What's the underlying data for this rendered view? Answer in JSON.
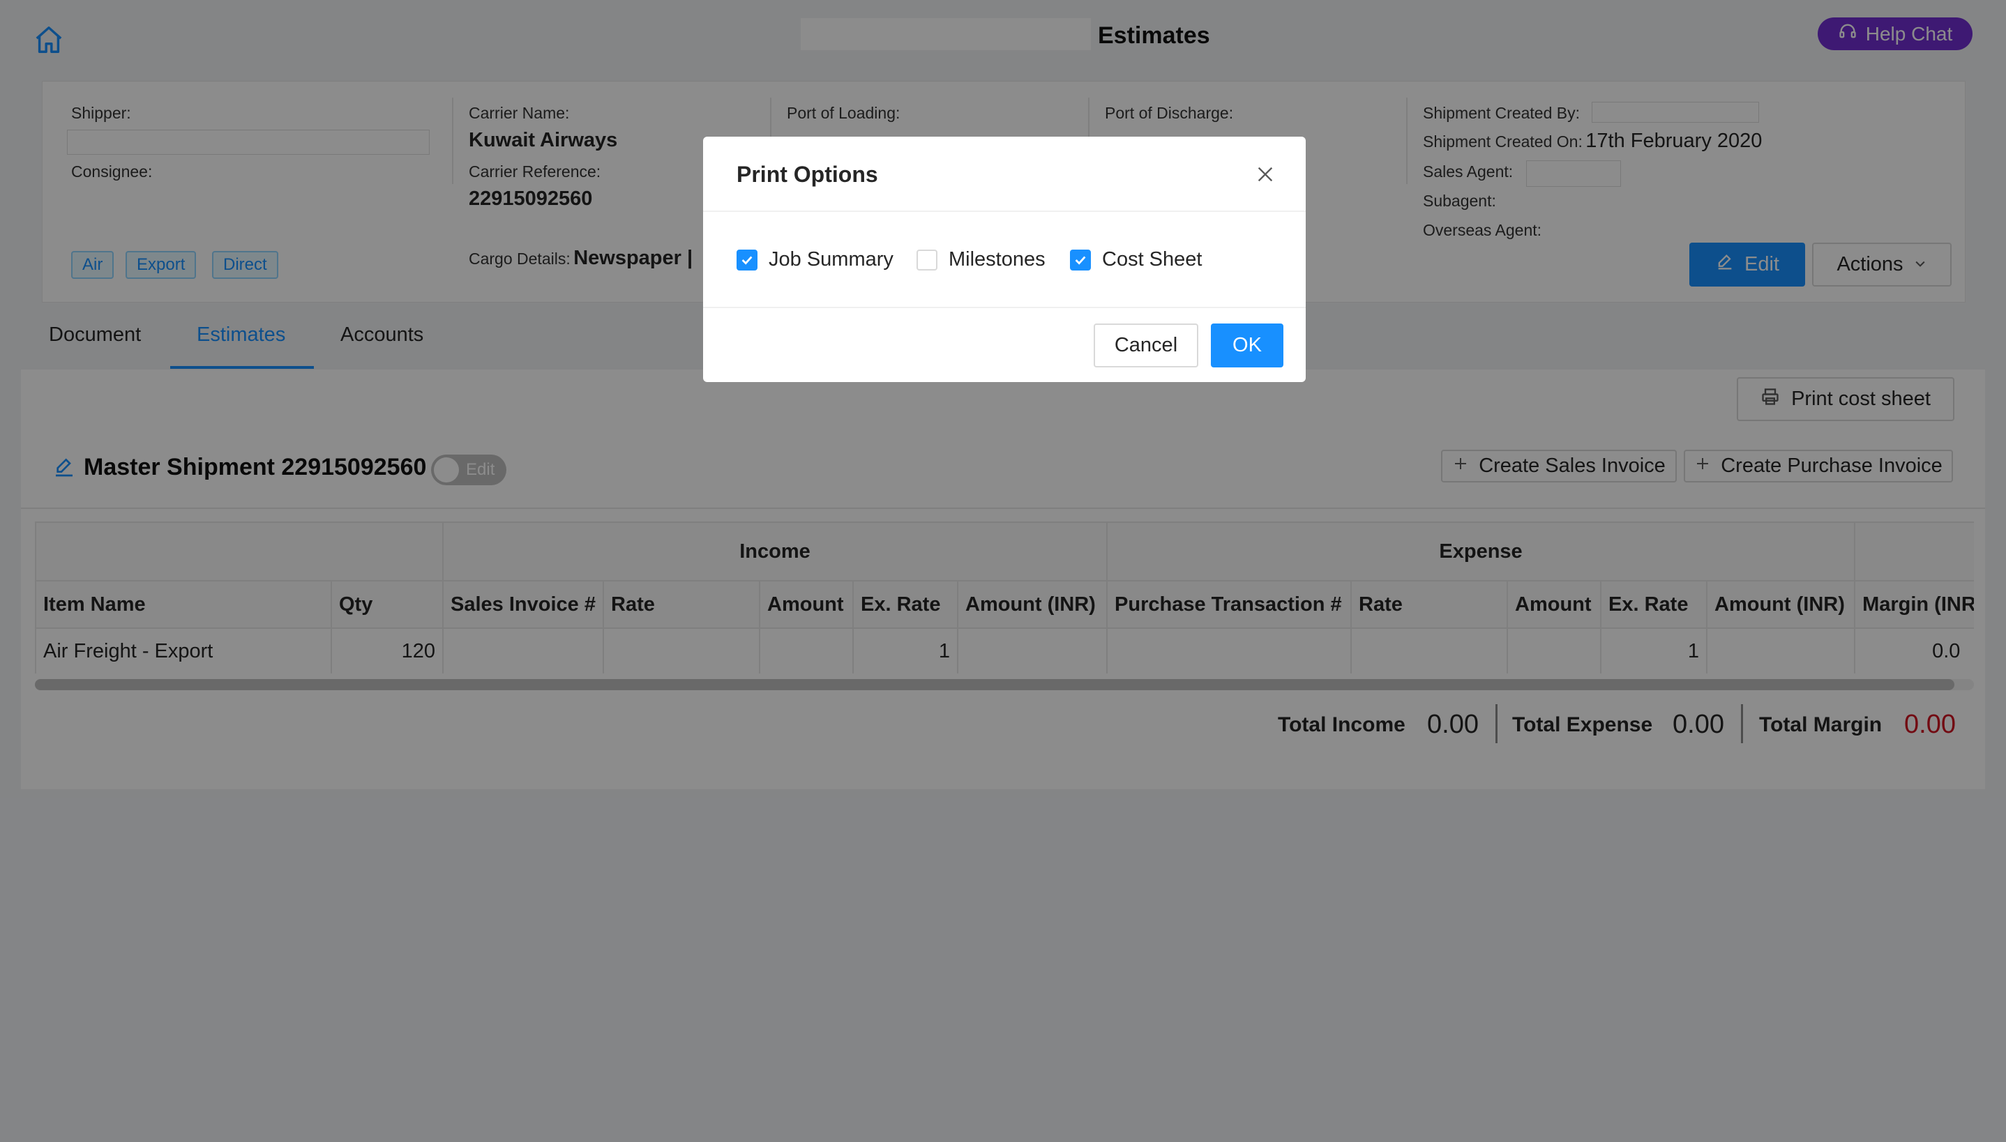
{
  "header": {
    "title": "Estimates",
    "help_chat_label": "Help Chat"
  },
  "shipment": {
    "shipper_label": "Shipper:",
    "consignee_label": "Consignee:",
    "tags": [
      "Air",
      "Export",
      "Direct"
    ],
    "carrier_name_label": "Carrier Name:",
    "carrier_name": "Kuwait Airways",
    "carrier_reference_label": "Carrier Reference:",
    "carrier_reference": "22915092560",
    "cargo_details_label": "Cargo Details:",
    "cargo_details": "Newspaper |",
    "port_loading_label": "Port of Loading:",
    "port_discharge_label": "Port of Discharge:",
    "created_by_label": "Shipment Created By:",
    "created_on_label": "Shipment Created On:",
    "created_on": "17th February 2020",
    "sales_agent_label": "Sales Agent:",
    "subagent_label": "Subagent:",
    "overseas_agent_label": "Overseas Agent:",
    "edit_label": "Edit",
    "actions_label": "Actions"
  },
  "tabs": [
    {
      "label": "Document",
      "active": false
    },
    {
      "label": "Estimates",
      "active": true
    },
    {
      "label": "Accounts",
      "active": false
    }
  ],
  "estimates": {
    "print_cost_sheet_label": "Print cost sheet",
    "master_title": "Master Shipment 22915092560",
    "switch_label": "Edit",
    "create_sales_invoice_label": "Create Sales Invoice",
    "create_purchase_invoice_label": "Create Purchase Invoice",
    "table": {
      "group_income": "Income",
      "group_expense": "Expense",
      "columns": [
        "Item Name",
        "Qty",
        "Sales Invoice #",
        "Rate",
        "Amount",
        "Ex. Rate",
        "Amount (INR)",
        "Purchase Transaction #",
        "Rate",
        "Amount",
        "Ex. Rate",
        "Amount (INR)",
        "Margin (INR)"
      ],
      "rows": [
        [
          "Air Freight - Export",
          "120",
          "",
          "",
          "",
          "1",
          "",
          "",
          "",
          "",
          "1",
          "",
          "0.0"
        ]
      ]
    },
    "totals": {
      "income_label": "Total Income",
      "income_value": "0.00",
      "expense_label": "Total Expense",
      "expense_value": "0.00",
      "margin_label": "Total Margin",
      "margin_value": "0.00",
      "margin_color": "#cf1322"
    }
  },
  "modal": {
    "title": "Print Options",
    "options": [
      {
        "label": "Job Summary",
        "checked": true
      },
      {
        "label": "Milestones",
        "checked": false
      },
      {
        "label": "Cost Sheet",
        "checked": true
      }
    ],
    "cancel_label": "Cancel",
    "ok_label": "OK"
  },
  "colors": {
    "primary": "#1890ff",
    "help_chat": "#722ed1"
  }
}
